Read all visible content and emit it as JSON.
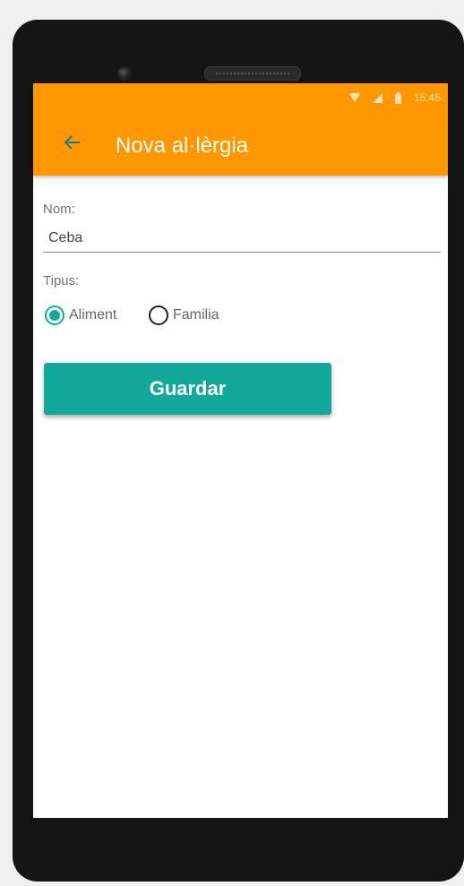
{
  "status_bar": {
    "time": "15:45",
    "icons": [
      "wifi-icon",
      "signal-icon",
      "battery-icon"
    ]
  },
  "app_bar": {
    "back_icon": "arrow-left-icon",
    "title": "Nova al·lèrgia",
    "color": "#ff9800"
  },
  "form": {
    "name_label": "Nom:",
    "name_value": "Ceba",
    "type_label": "Tipus:",
    "type_options": [
      {
        "label": "Aliment",
        "checked": true
      },
      {
        "label": "Familia",
        "checked": false
      }
    ],
    "save_label": "Guardar",
    "accent": "#12a99b"
  }
}
